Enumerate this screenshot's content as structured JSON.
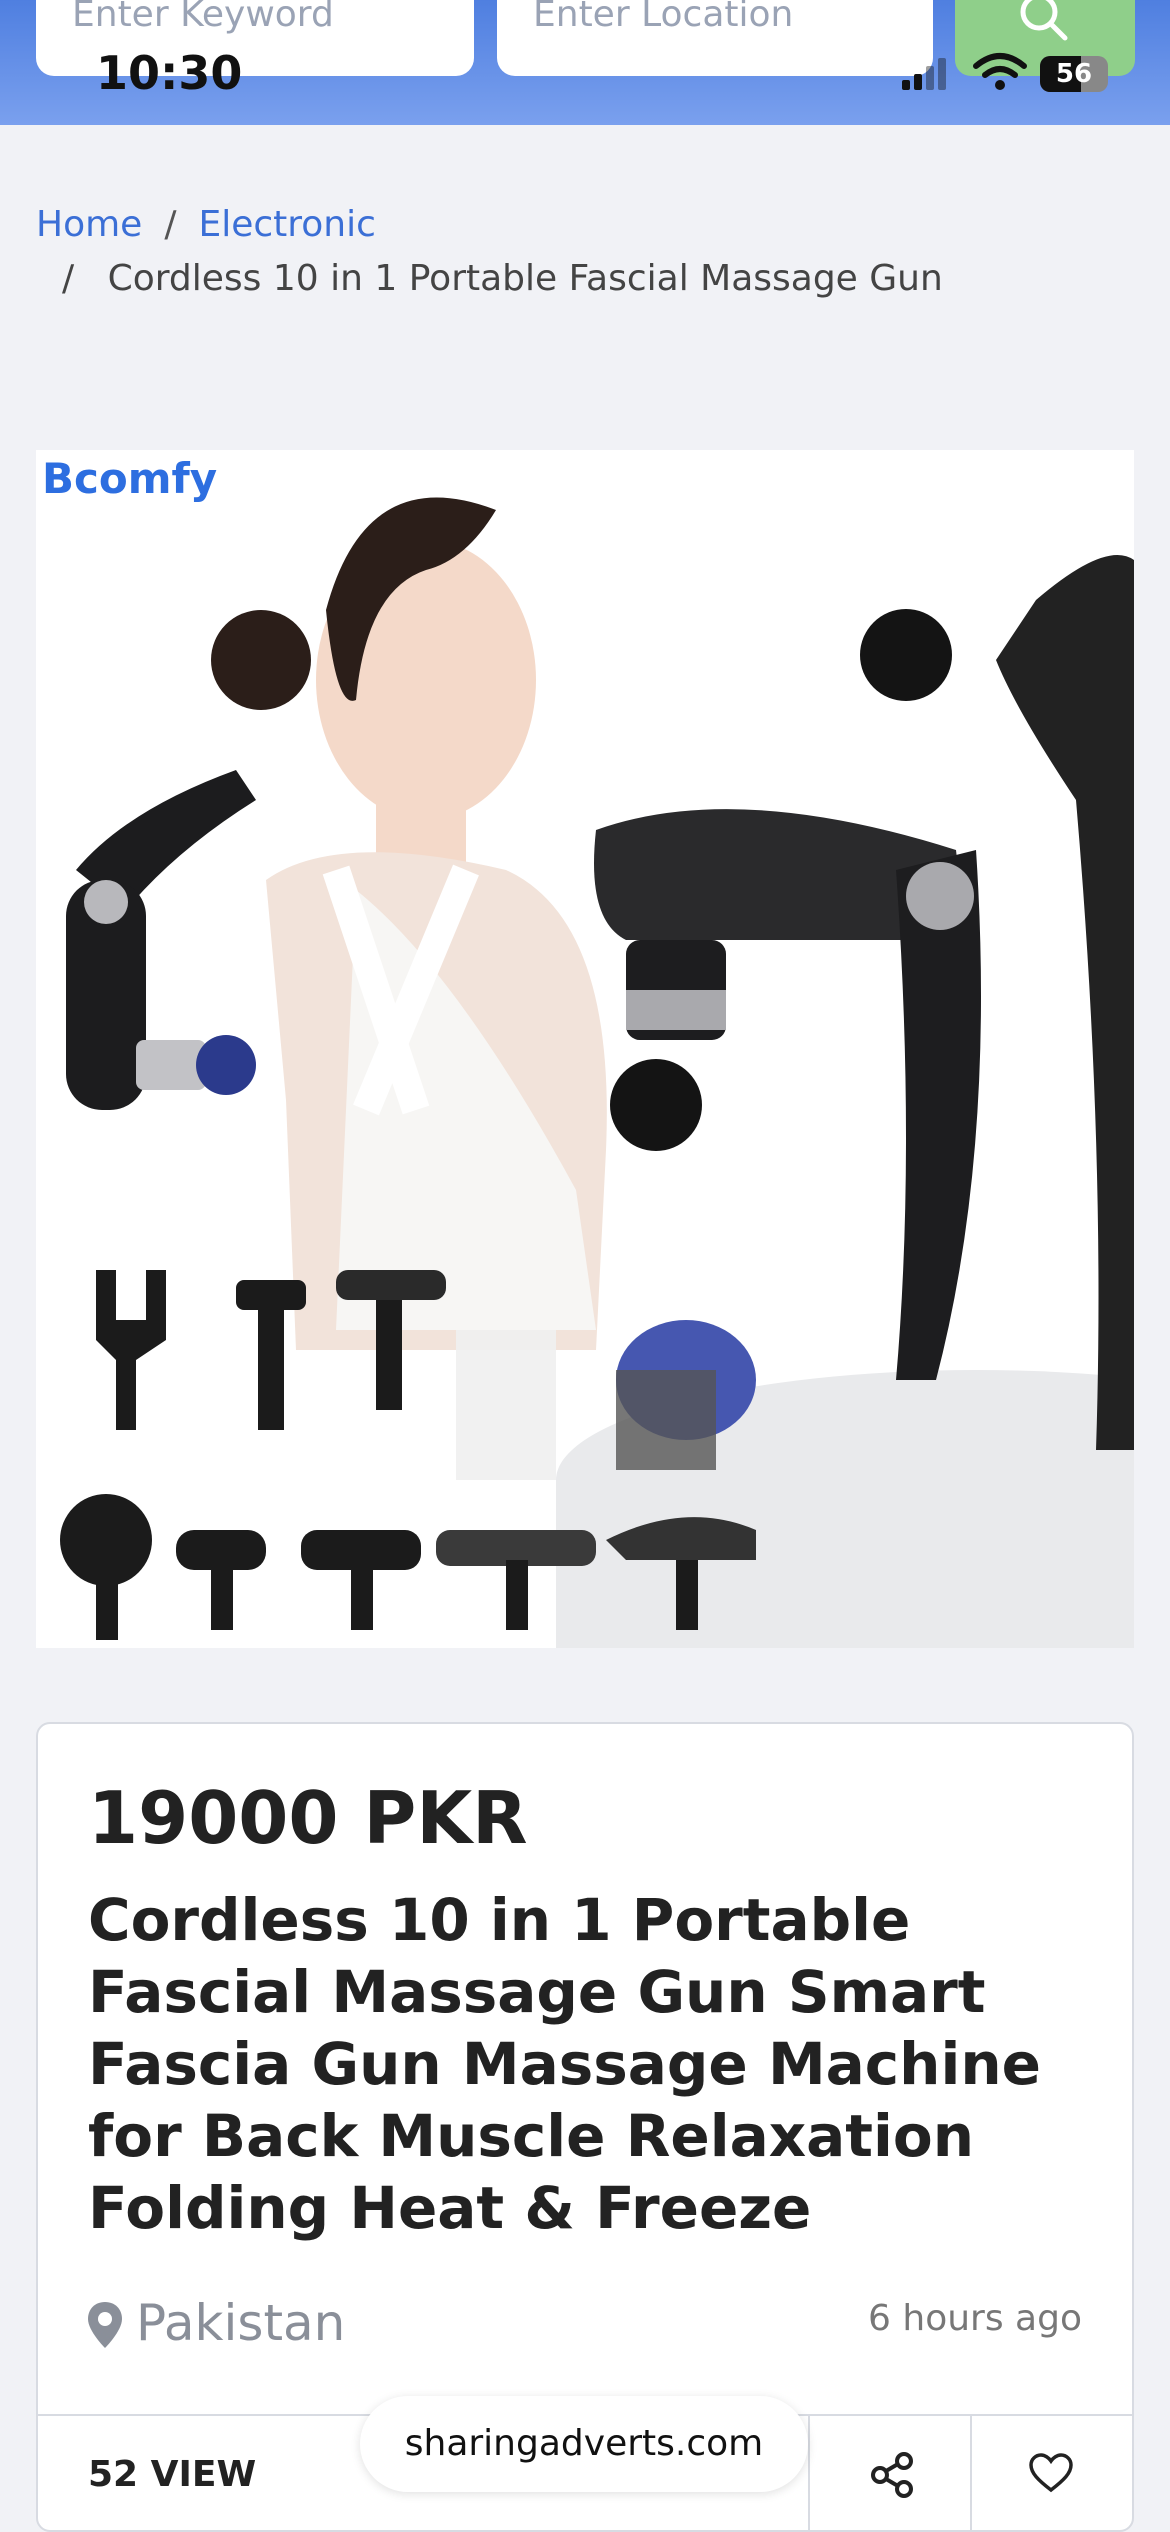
{
  "status_bar": {
    "time": "10:30",
    "battery": "56"
  },
  "header": {
    "keyword_placeholder": "Enter Keyword",
    "location_placeholder": "Enter Location"
  },
  "breadcrumb": {
    "home": "Home",
    "separator": "/",
    "category": "Electronic",
    "current": "Cordless 10 in 1 Portable Fascial Massage Gun"
  },
  "product_image": {
    "brand": "Bcomfy"
  },
  "listing": {
    "price": "19000 PKR",
    "title": "Cordless 10 in 1 Portable Fascial Massage Gun Smart Fascia Gun Massage Machine for Back Muscle Relaxation Folding Heat & Freeze",
    "location": "Pakistan",
    "posted": "6 hours ago",
    "views": "52 VIEW"
  },
  "browser": {
    "url": "sharingadverts.com"
  },
  "colors": {
    "header": "#5b86e5",
    "link": "#3b6fd6",
    "search_button": "#8fcf8a"
  }
}
